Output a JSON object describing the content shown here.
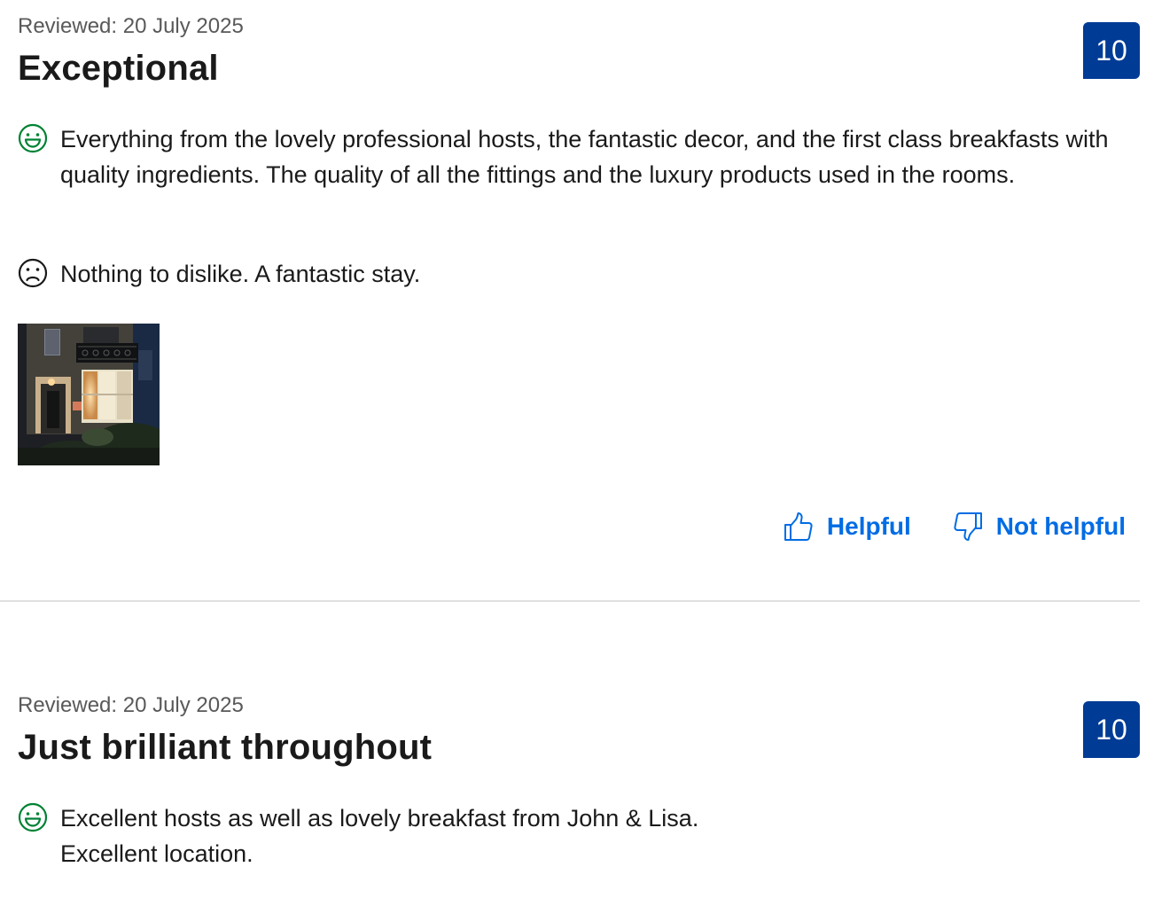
{
  "reviews": [
    {
      "date": "Reviewed: 20 July 2025",
      "title": "Exceptional",
      "score": "10",
      "positive": "Everything from the lovely professional hosts, the fantastic decor, and the first class breakfasts with quality ingredients. The quality of all the fittings and the luxury products used in the rooms.",
      "negative": "Nothing to dislike. A fantastic stay.",
      "photo_icon": "review-photo-thumbnail",
      "feedback": {
        "helpful_label": "Helpful",
        "not_helpful_label": "Not helpful"
      }
    },
    {
      "date": "Reviewed: 20 July 2025",
      "title": "Just brilliant throughout",
      "score": "10",
      "positive": "Excellent hosts as well as lovely breakfast from John & Lisa.\nExcellent location."
    }
  ],
  "colors": {
    "score_badge": "#003b95",
    "link": "#006ce4",
    "positive_icon": "#008234",
    "negative_icon": "#1a1a1a",
    "divider": "#e0e0e0"
  },
  "icons": {
    "positive": "smiling-face-icon",
    "negative": "frowning-face-icon",
    "helpful": "thumbs-up-icon",
    "not_helpful": "thumbs-down-icon"
  }
}
